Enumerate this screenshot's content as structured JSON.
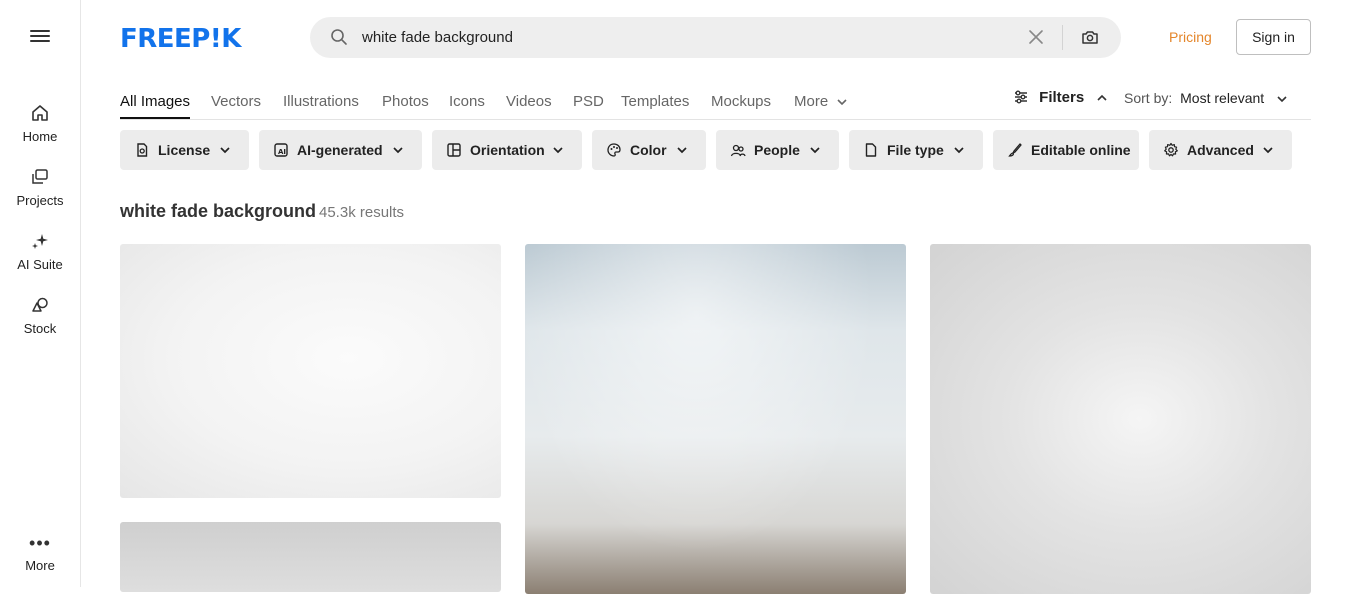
{
  "sidebar": {
    "items": [
      {
        "label": "Home",
        "icon": "home-icon"
      },
      {
        "label": "Projects",
        "icon": "projects-icon"
      },
      {
        "label": "AI Suite",
        "icon": "sparkles-icon"
      },
      {
        "label": "Stock",
        "icon": "stock-shapes-icon"
      }
    ],
    "more_label": "More"
  },
  "header": {
    "logo": "FREEP!K",
    "search_value": "white fade background",
    "pricing_label": "Pricing",
    "signin_label": "Sign in",
    "colors": {
      "brand": "#1273eb",
      "pricing": "#e4862b"
    }
  },
  "tabs": {
    "items": [
      "All Images",
      "Vectors",
      "Illustrations",
      "Photos",
      "Icons",
      "Videos",
      "PSD",
      "Templates",
      "Mockups",
      "More"
    ],
    "active": "All Images",
    "filters_label": "Filters",
    "sort_label": "Sort by:",
    "sort_value": "Most relevant"
  },
  "filters": [
    {
      "label": "License",
      "icon": "license-icon"
    },
    {
      "label": "AI-generated",
      "icon": "ai-image-icon"
    },
    {
      "label": "Orientation",
      "icon": "orientation-icon"
    },
    {
      "label": "Color",
      "icon": "palette-icon"
    },
    {
      "label": "People",
      "icon": "people-icon"
    },
    {
      "label": "File type",
      "icon": "file-icon"
    },
    {
      "label": "Editable online",
      "icon": "brush-icon"
    },
    {
      "label": "Advanced",
      "icon": "gear-icon"
    }
  ],
  "results": {
    "query": "white fade background",
    "count": "45.3k results"
  }
}
